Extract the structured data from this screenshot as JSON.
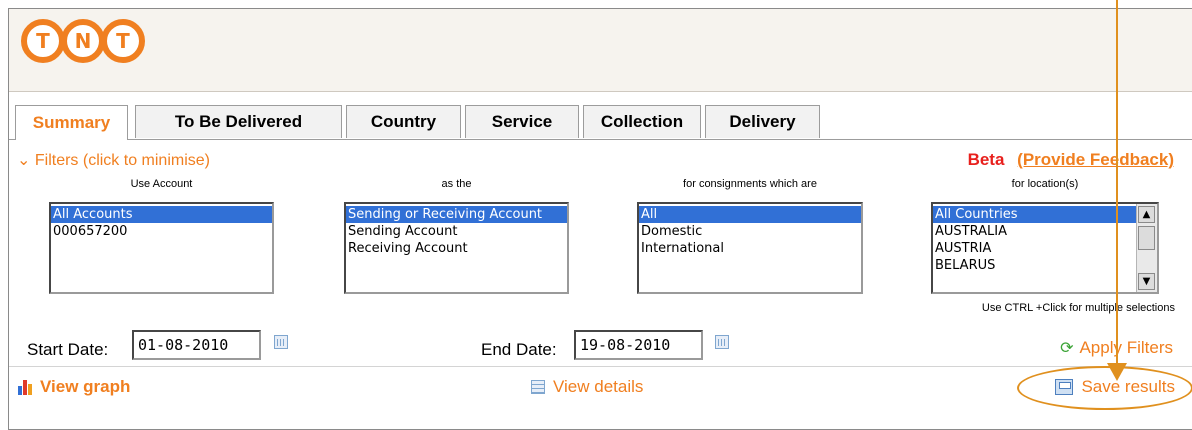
{
  "logo": {
    "letters": [
      "T",
      "N",
      "T"
    ]
  },
  "tabs": [
    {
      "label": "Summary",
      "active": true
    },
    {
      "label": "To Be Delivered",
      "active": false
    },
    {
      "label": "Country",
      "active": false
    },
    {
      "label": "Service",
      "active": false
    },
    {
      "label": "Collection",
      "active": false
    },
    {
      "label": "Delivery",
      "active": false
    }
  ],
  "filters": {
    "toggle_label": "Filters (click to minimise)",
    "toggle_icon": "chevron-down-icon",
    "beta_label": "Beta",
    "feedback_link": "(Provide Feedback)"
  },
  "columns": {
    "account_label": "Use Account",
    "as_label": "as the",
    "consignment_label": "for consignments which are",
    "location_label": "for location(s)"
  },
  "lists": {
    "account": [
      "All Accounts",
      "000657200"
    ],
    "role": [
      "Sending or Receiving Account",
      "Sending Account",
      "Receiving Account"
    ],
    "consignment": [
      "All",
      "Domestic",
      "International"
    ],
    "location": [
      "All Countries",
      "AUSTRALIA",
      "AUSTRIA",
      "BELARUS"
    ]
  },
  "ctrl_hint": "Use CTRL +Click for multiple selections",
  "dates": {
    "start_label": "Start Date:",
    "start_value": "01-08-2010",
    "end_label": "End Date:",
    "end_value": "19-08-2010"
  },
  "apply_filters": "Apply Filters",
  "bottom": {
    "view_graph": "View graph",
    "view_details": "View details",
    "save_results": "Save results"
  },
  "colors": {
    "accent": "#f07f20",
    "selection": "#3170d6",
    "beta": "#e8201d",
    "annotation": "#e0901e"
  }
}
